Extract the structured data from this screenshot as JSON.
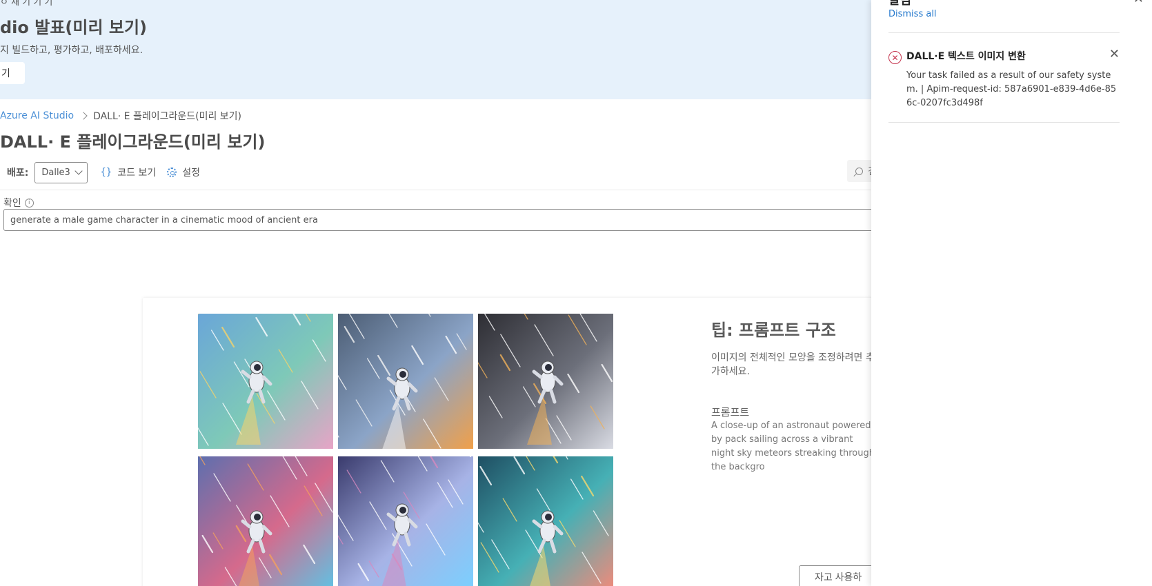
{
  "banner": {
    "top_text": "ㅇ 새 기 기 기",
    "title": "dio 발표(미리 보기)",
    "subtitle": "지 빌드하고, 평가하고, 배포하세요.",
    "button_label": "기"
  },
  "breadcrumb": {
    "root": "Azure AI Studio",
    "current": "DALL· E 플레이그라운드(미리 보기)"
  },
  "page": {
    "title": "DALL· E 플레이그라운드(미리 보기)"
  },
  "toolbar": {
    "deploy_label": "배포:",
    "deploy_value": "Dalle3",
    "code_icon": "{}",
    "code_label": "코드 보기",
    "settings_label": "설정",
    "search_placeholder": "검색"
  },
  "prompt": {
    "label": "확인",
    "value": "generate a male game character in a cinematic mood of ancient era"
  },
  "gallery": {
    "images": [
      {
        "name": "astronaut-image-1",
        "colors": [
          "#6aa6d8",
          "#7ec9b8",
          "#e7a4c6",
          "#f6d36b"
        ]
      },
      {
        "name": "astronaut-image-2",
        "colors": [
          "#4c5d74",
          "#8ba4c7",
          "#f0a04a",
          "#f3f3f3"
        ]
      },
      {
        "name": "astronaut-image-3",
        "colors": [
          "#2e2e34",
          "#6c6f7a",
          "#d9dbe3",
          "#f0b15a"
        ]
      },
      {
        "name": "astronaut-image-4",
        "colors": [
          "#5e6fae",
          "#d56a8c",
          "#5fc3e4",
          "#f4a15e"
        ]
      },
      {
        "name": "astronaut-image-5",
        "colors": [
          "#3a3b6d",
          "#a7b3e6",
          "#7ad0ff",
          "#d78ac0"
        ]
      },
      {
        "name": "astronaut-image-6",
        "colors": [
          "#1f4f63",
          "#46b0b5",
          "#f28a7a",
          "#f6d86f"
        ]
      }
    ]
  },
  "tip": {
    "title": "팁: 프롬프트 구조",
    "description": "이미지의 전체적인 모양을 조정하려면 추가하세요.",
    "prompt_heading": "프롬프트",
    "prompt_text": "A close-up of an astronaut powered by pack sailing across a vibrant night sky meteors streaking through the backgro",
    "use_button": "자고 사용하"
  },
  "notifications": {
    "heading": "알림",
    "dismiss_all": "Dismiss all",
    "items": [
      {
        "title": "DALL·E 텍스트 이미지 변환",
        "body": "Your task failed as a result of our safety system. | Apim-request-id: 587a6901-e839-4d6e-856c-0207fc3d498f"
      }
    ]
  },
  "colors": {
    "banner_bg": "#e6f1fb",
    "accent": "#4a8fd6",
    "error": "#c4314b"
  }
}
